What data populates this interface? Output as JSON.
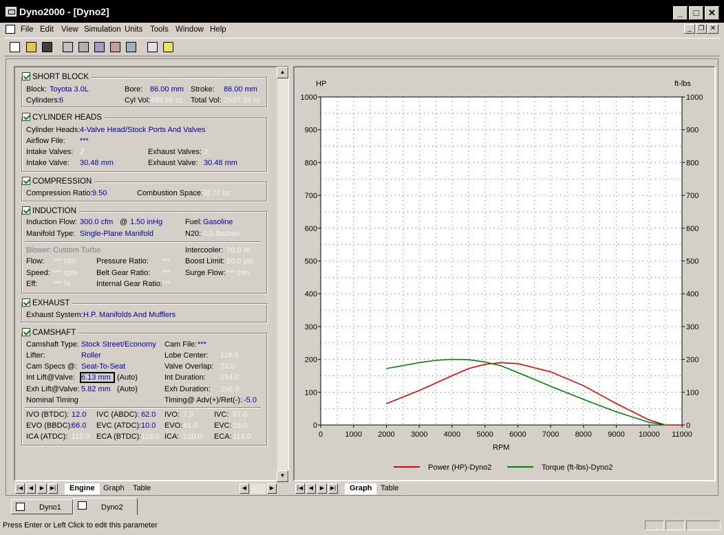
{
  "window": {
    "title": "Dyno2000 - [Dyno2]",
    "minimize": "_",
    "maximize": "□",
    "close": "✕"
  },
  "menu": {
    "items": [
      "File",
      "Edit",
      "View",
      "Simulation",
      "Units",
      "Tools",
      "Window",
      "Help"
    ]
  },
  "toolbar": {
    "buttons": [
      "new-icon",
      "open-icon",
      "save-icon",
      "run-icon",
      "calc-icon",
      "edit-icon",
      "import-icon",
      "compare-icon",
      "print-icon",
      "help-icon"
    ]
  },
  "short_block": {
    "title": "SHORT BLOCK",
    "block_label": "Block:",
    "block_value": "Toyota 3.0L",
    "bore_label": "Bore:",
    "bore_value": "86.00 mm",
    "stroke_label": "Stroke:",
    "stroke_value": "86.00 mm",
    "cylinders_label": "Cylinders:",
    "cylinders_value": "6",
    "cylvol_label": "Cyl Vol:",
    "cylvol_value": "499.56 cc",
    "totalvol_label": "Total Vol:",
    "totalvol_value": "2997.34 cc"
  },
  "cylinder_heads": {
    "title": "CYLINDER HEADS",
    "heads_label": "Cylinder Heads:",
    "heads_value": "4-Valve Head/Stock Ports And Valves",
    "airflow_label": "Airflow File:",
    "airflow_value": "***",
    "intake_valves_label": "Intake Valves:",
    "intake_valves_value": "2",
    "exhaust_valves_label": "Exhaust Valves:",
    "exhaust_valves_value": "2",
    "intake_valve_label": "Intake Valve:",
    "intake_valve_value": "30.48 mm",
    "exhaust_valve_label": "Exhaust Valve:",
    "exhaust_valve_value": "30.48 mm"
  },
  "compression": {
    "title": "COMPRESSION",
    "ratio_label": "Compression Ratio:",
    "ratio_value": "9.50",
    "space_label": "Combustion Space:",
    "space_value": "58.77 cc"
  },
  "induction": {
    "title": "INDUCTION",
    "flow_label": "Induction Flow:",
    "flow_value": "300.0 cfm",
    "at_label": "@",
    "at_value": "1.50 inHg",
    "fuel_label": "Fuel:",
    "fuel_value": "Gasoline",
    "manifold_label": "Manifold Type:",
    "manifold_value": "Single-Plane Manifold",
    "n20_label": "N20:",
    "n20_value": "0.0 lbs/min",
    "blower_label": "Blower:",
    "blower_value": "Custom Turbo",
    "intercooler_label": "Intercooler:",
    "intercooler_value": "70.0 %",
    "flow2_label": "Flow:",
    "flow2_value": "*** cfm",
    "pressure_label": "Pressure Ratio:",
    "pressure_value": "***",
    "boost_label": "Boost Limit:",
    "boost_value": "10.0 psi",
    "speed_label": "Speed:",
    "speed_value": "*** rpm",
    "belt_label": "Belt Gear Ratio:",
    "belt_value": "***",
    "surge_label": "Surge Flow:",
    "surge_value": "*** cfm",
    "eff_label": "Eff:",
    "eff_value": "*** %",
    "internal_label": "Internal Gear Ratio:",
    "internal_value": "***"
  },
  "exhaust": {
    "title": "EXHAUST",
    "system_label": "Exhaust System:",
    "system_value": "H.P. Manifolds And Mufflers"
  },
  "camshaft": {
    "title": "CAMSHAFT",
    "type_label": "Camshaft Type:",
    "type_value": "Stock Street/Economy",
    "file_label": "Cam File:",
    "file_value": "***",
    "lifter_label": "Lifter:",
    "lifter_value": "Roller",
    "lobe_label": "Lobe Center:",
    "lobe_value": "116.5",
    "specs_label": "Cam Specs @:",
    "specs_value": "Seat-To-Seat",
    "overlap_label": "Valve Overlap:",
    "overlap_value": "22.0",
    "int_lift_label": "Int Lift@Valve:",
    "int_lift_value": "6.13 mm",
    "int_lift_auto": "(Auto)",
    "int_dur_label": "Int Duration:",
    "int_dur_value": "254.0",
    "exh_lift_label": "Exh Lift@Valve:",
    "exh_lift_value": "5.82 mm",
    "exh_lift_auto": "(Auto)",
    "exh_dur_label": "Exh Duration:",
    "exh_dur_value": "256.0",
    "nominal_label": "Nominal Timing",
    "timing_label": "Timing@ Adv(+)/Ret(-):",
    "timing_value": "-5.0",
    "ivo_btdc_label": "IVO  (BTDC):",
    "ivo_btdc_value": "12.0",
    "ivc_abdc_label": "IVC  (ABDC):",
    "ivc_abdc_value": "62.0",
    "ivo_label": "IVO:",
    "ivo_value": "7.0",
    "ivc_label": "IVC:",
    "ivc_value": "67.0",
    "evo_bbdc_label": "EVO (BBDC):",
    "evo_bbdc_value": "66.0",
    "evc_atdc_label": "EVC (ATDC):",
    "evc_atdc_value": "10.0",
    "evo_label": "EVO:",
    "evo_value": "61.0",
    "evc_label": "EVC:",
    "evc_value": "15.0",
    "ica_atdc_label": "ICA  (ATDC):",
    "ica_atdc_value": "115.0",
    "eca_btdc_label": "ECA (BTDC):",
    "eca_btdc_value": "118.0",
    "ica_label": "ICA:",
    "ica_value": "120.0",
    "eca_label": "ECA:",
    "eca_value": "113.0"
  },
  "left_tabs": {
    "engine": "Engine",
    "graph": "Graph",
    "table": "Table"
  },
  "right_tabs": {
    "graph": "Graph",
    "table": "Table"
  },
  "doc_tabs": [
    "Dyno1",
    "Dyno2"
  ],
  "status": {
    "text": "Press Enter or Left Click to edit this parameter"
  },
  "chart_data": {
    "type": "line",
    "xlabel": "RPM",
    "ylabel_left": "HP",
    "ylabel_right": "ft-lbs",
    "xlim": [
      0,
      11000
    ],
    "ylim": [
      0,
      1000
    ],
    "xticks": [
      0,
      1000,
      2000,
      3000,
      4000,
      5000,
      6000,
      7000,
      8000,
      9000,
      10000,
      11000
    ],
    "yticks": [
      0,
      100,
      200,
      300,
      400,
      500,
      600,
      700,
      800,
      900,
      1000
    ],
    "grid": true,
    "legend": "bottom",
    "series": [
      {
        "name": "Power (HP)-Dyno2",
        "color": "#e00000",
        "x": [
          2000,
          3000,
          4000,
          4500,
          5000,
          5500,
          6000,
          7000,
          8000,
          9000,
          10000,
          10500,
          11000
        ],
        "values": [
          65,
          105,
          150,
          172,
          185,
          190,
          187,
          162,
          120,
          65,
          15,
          0,
          0
        ]
      },
      {
        "name": "Torque (ft-lbs)-Dyno2",
        "color": "#008000",
        "x": [
          2000,
          2500,
          3000,
          3500,
          4000,
          4500,
          5000,
          5500,
          6000,
          7000,
          8000,
          9000,
          10000,
          10500
        ],
        "values": [
          172,
          181,
          190,
          197,
          200,
          199,
          192,
          180,
          160,
          118,
          78,
          40,
          8,
          0
        ]
      }
    ]
  }
}
